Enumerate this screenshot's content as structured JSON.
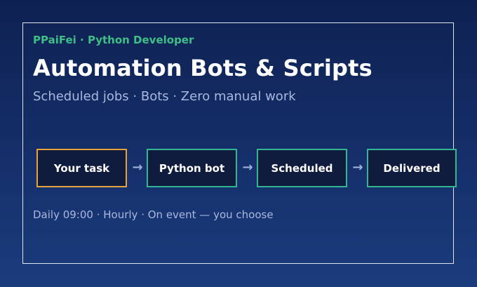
{
  "header": {
    "eyebrow": "PPaiFei · Python Developer",
    "title": "Automation Bots & Scripts",
    "subtitle": "Scheduled jobs · Bots · Zero manual work"
  },
  "flow": {
    "steps": [
      {
        "label": "Your task"
      },
      {
        "label": "Python bot"
      },
      {
        "label": "Scheduled"
      },
      {
        "label": "Delivered"
      }
    ],
    "arrow_glyph": "→",
    "colors": {
      "start_border": "#e7a23b",
      "step_border": "#36b592",
      "step_fill": "#0f1c3d"
    }
  },
  "footer": {
    "text": "Daily 09:00 · Hourly · On event — you choose"
  },
  "colors": {
    "background_top": "#0e2152",
    "background_bottom": "#1b3c7d",
    "accent": "#3fbf86",
    "card_border": "#dfe6f5"
  }
}
